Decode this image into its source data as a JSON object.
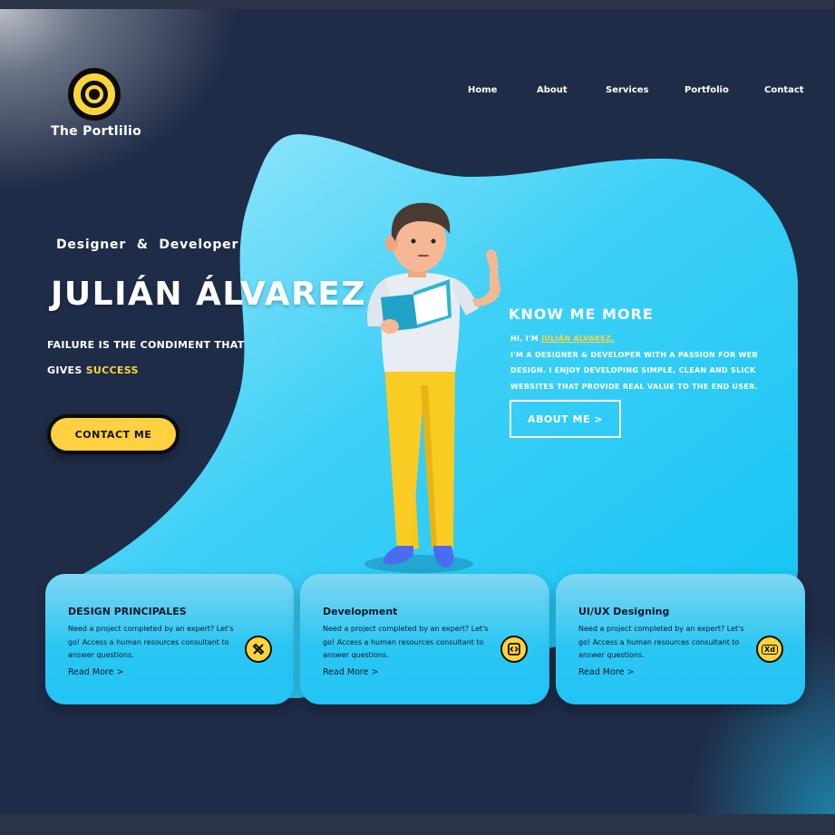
{
  "brand": {
    "name": "The Portlilio"
  },
  "nav": {
    "items": [
      "Home",
      "About",
      "Services",
      "Portfolio",
      "Contact"
    ]
  },
  "hero": {
    "subtitle": "Designer  &  Developer",
    "name": "JULIÁN ÁLVAREZ",
    "tagline_line1": "FAILURE IS THE CONDIMENT THAT",
    "tagline_line2_prefix": "GIVES ",
    "tagline_line2_highlight": "SUCCESS",
    "contact_label": "CONTACT ME"
  },
  "about": {
    "title": "KNOW ME MORE",
    "greeting_prefix": "HI, I'M ",
    "greeting_name": "JULIÁN ÁLVAREZ,",
    "description": "I'M A DESIGNER & DEVELOPER WITH A PASSION FOR WEB DESIGN. I ENJOY DEVELOPING SIMPLE, CLEAN AND SLICK WEBSITES THAT PROVIDE REAL VALUE TO THE END USER.",
    "button_label": "ABOUT ME >"
  },
  "cards": [
    {
      "title": "DESIGN PRINCIPALES",
      "text": "Need a project completed by an expert? Let's go! Access a human resources consultant to answer questions.",
      "link": "Read More >",
      "icon": "design-tools-icon"
    },
    {
      "title": "Development",
      "text": "Need a project completed by an expert? Let's go! Access a human resources consultant to answer questions.",
      "link": "Read More >",
      "icon": "code-icon"
    },
    {
      "title": "UI/UX Designing",
      "text": "Need a project completed by an expert? Let's go! Access a human resources consultant to answer questions.",
      "link": "Read More >",
      "icon": "xd-icon",
      "icon_text": "Xd"
    }
  ],
  "colors": {
    "accent": "#ffd43b",
    "background": "#1f2c47",
    "cyan": "#22c4f5"
  }
}
